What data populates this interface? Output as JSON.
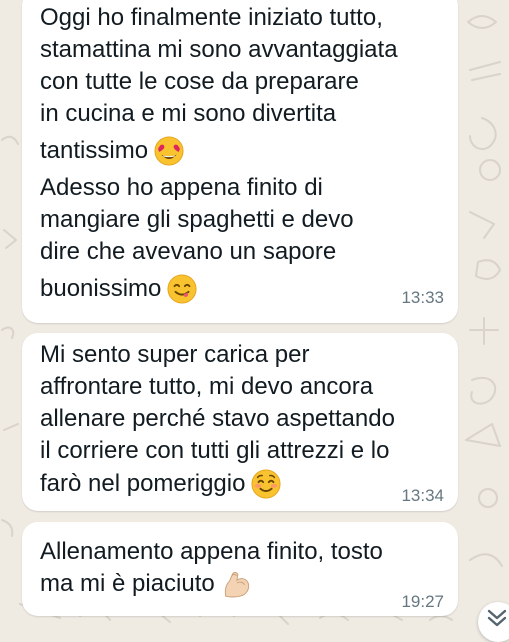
{
  "chat": {
    "messages": [
      {
        "lines": [
          "Oggi ho finalmente iniziato tutto,",
          "stamattina mi sono avvantaggiata",
          "con tutte le cose da preparare",
          "in cucina e mi sono divertita",
          "tantissimo",
          "Adesso ho appena finito di",
          "mangiare gli spaghetti e devo",
          "dire che avevano un sapore",
          "buonissimo"
        ],
        "time": "13:33"
      },
      {
        "lines": [
          "Mi sento super carica per",
          "affrontare tutto, mi devo ancora",
          "allenare perché stavo aspettando",
          "il corriere con tutti gli attrezzi e lo",
          "farò nel pomeriggio"
        ],
        "time": "13:34"
      },
      {
        "lines": [
          "Allenamento appena finito, tosto",
          "ma mi è piaciuto"
        ],
        "time": "19:27"
      }
    ]
  },
  "icons": {
    "emoji_1": "heart-eyes-emoji-icon",
    "emoji_2": "yum-face-emoji-icon",
    "emoji_3": "smiling-blush-emoji-icon",
    "emoji_4": "flexed-biceps-emoji-icon",
    "scroll": "chevron-down-icon"
  },
  "colors": {
    "background": "#efeae2",
    "bubble": "#ffffff",
    "text": "#111b21",
    "timestamp": "#667781"
  }
}
